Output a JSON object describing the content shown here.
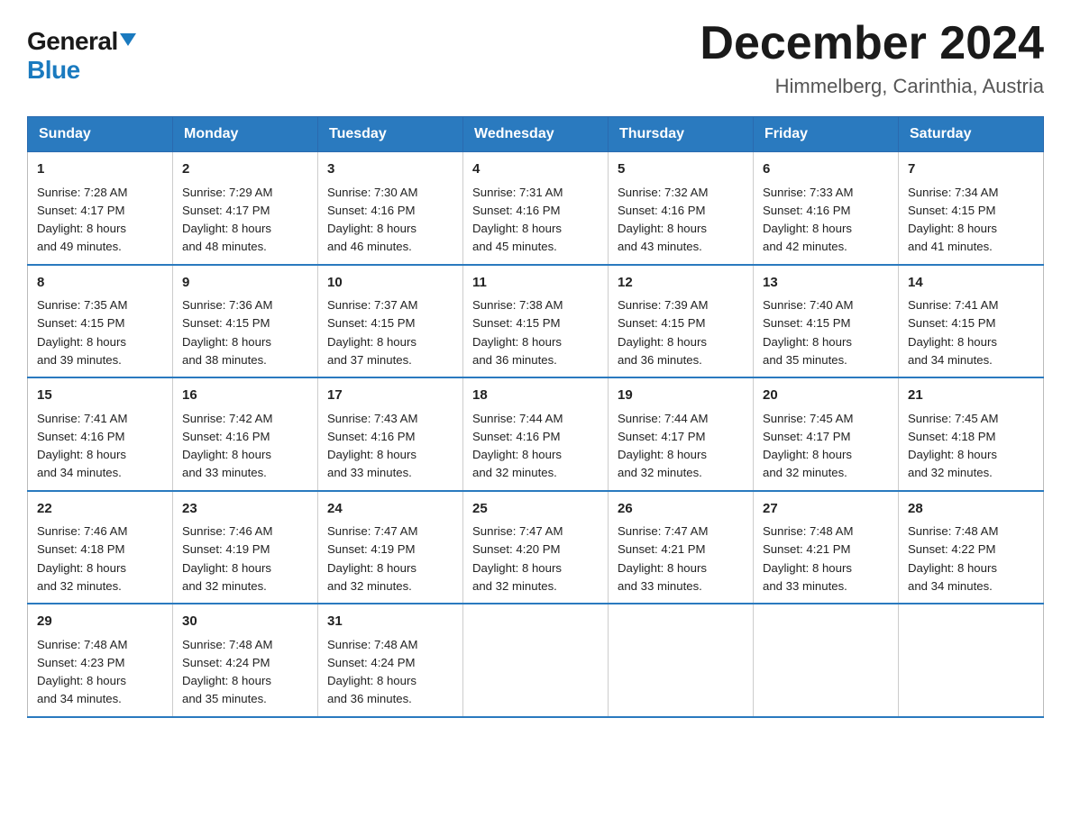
{
  "header": {
    "logo_general": "General",
    "logo_blue": "Blue",
    "title": "December 2024",
    "subtitle": "Himmelberg, Carinthia, Austria"
  },
  "days_of_week": [
    "Sunday",
    "Monday",
    "Tuesday",
    "Wednesday",
    "Thursday",
    "Friday",
    "Saturday"
  ],
  "weeks": [
    [
      {
        "day": "1",
        "sunrise": "Sunrise: 7:28 AM",
        "sunset": "Sunset: 4:17 PM",
        "daylight": "Daylight: 8 hours",
        "daylight2": "and 49 minutes."
      },
      {
        "day": "2",
        "sunrise": "Sunrise: 7:29 AM",
        "sunset": "Sunset: 4:17 PM",
        "daylight": "Daylight: 8 hours",
        "daylight2": "and 48 minutes."
      },
      {
        "day": "3",
        "sunrise": "Sunrise: 7:30 AM",
        "sunset": "Sunset: 4:16 PM",
        "daylight": "Daylight: 8 hours",
        "daylight2": "and 46 minutes."
      },
      {
        "day": "4",
        "sunrise": "Sunrise: 7:31 AM",
        "sunset": "Sunset: 4:16 PM",
        "daylight": "Daylight: 8 hours",
        "daylight2": "and 45 minutes."
      },
      {
        "day": "5",
        "sunrise": "Sunrise: 7:32 AM",
        "sunset": "Sunset: 4:16 PM",
        "daylight": "Daylight: 8 hours",
        "daylight2": "and 43 minutes."
      },
      {
        "day": "6",
        "sunrise": "Sunrise: 7:33 AM",
        "sunset": "Sunset: 4:16 PM",
        "daylight": "Daylight: 8 hours",
        "daylight2": "and 42 minutes."
      },
      {
        "day": "7",
        "sunrise": "Sunrise: 7:34 AM",
        "sunset": "Sunset: 4:15 PM",
        "daylight": "Daylight: 8 hours",
        "daylight2": "and 41 minutes."
      }
    ],
    [
      {
        "day": "8",
        "sunrise": "Sunrise: 7:35 AM",
        "sunset": "Sunset: 4:15 PM",
        "daylight": "Daylight: 8 hours",
        "daylight2": "and 39 minutes."
      },
      {
        "day": "9",
        "sunrise": "Sunrise: 7:36 AM",
        "sunset": "Sunset: 4:15 PM",
        "daylight": "Daylight: 8 hours",
        "daylight2": "and 38 minutes."
      },
      {
        "day": "10",
        "sunrise": "Sunrise: 7:37 AM",
        "sunset": "Sunset: 4:15 PM",
        "daylight": "Daylight: 8 hours",
        "daylight2": "and 37 minutes."
      },
      {
        "day": "11",
        "sunrise": "Sunrise: 7:38 AM",
        "sunset": "Sunset: 4:15 PM",
        "daylight": "Daylight: 8 hours",
        "daylight2": "and 36 minutes."
      },
      {
        "day": "12",
        "sunrise": "Sunrise: 7:39 AM",
        "sunset": "Sunset: 4:15 PM",
        "daylight": "Daylight: 8 hours",
        "daylight2": "and 36 minutes."
      },
      {
        "day": "13",
        "sunrise": "Sunrise: 7:40 AM",
        "sunset": "Sunset: 4:15 PM",
        "daylight": "Daylight: 8 hours",
        "daylight2": "and 35 minutes."
      },
      {
        "day": "14",
        "sunrise": "Sunrise: 7:41 AM",
        "sunset": "Sunset: 4:15 PM",
        "daylight": "Daylight: 8 hours",
        "daylight2": "and 34 minutes."
      }
    ],
    [
      {
        "day": "15",
        "sunrise": "Sunrise: 7:41 AM",
        "sunset": "Sunset: 4:16 PM",
        "daylight": "Daylight: 8 hours",
        "daylight2": "and 34 minutes."
      },
      {
        "day": "16",
        "sunrise": "Sunrise: 7:42 AM",
        "sunset": "Sunset: 4:16 PM",
        "daylight": "Daylight: 8 hours",
        "daylight2": "and 33 minutes."
      },
      {
        "day": "17",
        "sunrise": "Sunrise: 7:43 AM",
        "sunset": "Sunset: 4:16 PM",
        "daylight": "Daylight: 8 hours",
        "daylight2": "and 33 minutes."
      },
      {
        "day": "18",
        "sunrise": "Sunrise: 7:44 AM",
        "sunset": "Sunset: 4:16 PM",
        "daylight": "Daylight: 8 hours",
        "daylight2": "and 32 minutes."
      },
      {
        "day": "19",
        "sunrise": "Sunrise: 7:44 AM",
        "sunset": "Sunset: 4:17 PM",
        "daylight": "Daylight: 8 hours",
        "daylight2": "and 32 minutes."
      },
      {
        "day": "20",
        "sunrise": "Sunrise: 7:45 AM",
        "sunset": "Sunset: 4:17 PM",
        "daylight": "Daylight: 8 hours",
        "daylight2": "and 32 minutes."
      },
      {
        "day": "21",
        "sunrise": "Sunrise: 7:45 AM",
        "sunset": "Sunset: 4:18 PM",
        "daylight": "Daylight: 8 hours",
        "daylight2": "and 32 minutes."
      }
    ],
    [
      {
        "day": "22",
        "sunrise": "Sunrise: 7:46 AM",
        "sunset": "Sunset: 4:18 PM",
        "daylight": "Daylight: 8 hours",
        "daylight2": "and 32 minutes."
      },
      {
        "day": "23",
        "sunrise": "Sunrise: 7:46 AM",
        "sunset": "Sunset: 4:19 PM",
        "daylight": "Daylight: 8 hours",
        "daylight2": "and 32 minutes."
      },
      {
        "day": "24",
        "sunrise": "Sunrise: 7:47 AM",
        "sunset": "Sunset: 4:19 PM",
        "daylight": "Daylight: 8 hours",
        "daylight2": "and 32 minutes."
      },
      {
        "day": "25",
        "sunrise": "Sunrise: 7:47 AM",
        "sunset": "Sunset: 4:20 PM",
        "daylight": "Daylight: 8 hours",
        "daylight2": "and 32 minutes."
      },
      {
        "day": "26",
        "sunrise": "Sunrise: 7:47 AM",
        "sunset": "Sunset: 4:21 PM",
        "daylight": "Daylight: 8 hours",
        "daylight2": "and 33 minutes."
      },
      {
        "day": "27",
        "sunrise": "Sunrise: 7:48 AM",
        "sunset": "Sunset: 4:21 PM",
        "daylight": "Daylight: 8 hours",
        "daylight2": "and 33 minutes."
      },
      {
        "day": "28",
        "sunrise": "Sunrise: 7:48 AM",
        "sunset": "Sunset: 4:22 PM",
        "daylight": "Daylight: 8 hours",
        "daylight2": "and 34 minutes."
      }
    ],
    [
      {
        "day": "29",
        "sunrise": "Sunrise: 7:48 AM",
        "sunset": "Sunset: 4:23 PM",
        "daylight": "Daylight: 8 hours",
        "daylight2": "and 34 minutes."
      },
      {
        "day": "30",
        "sunrise": "Sunrise: 7:48 AM",
        "sunset": "Sunset: 4:24 PM",
        "daylight": "Daylight: 8 hours",
        "daylight2": "and 35 minutes."
      },
      {
        "day": "31",
        "sunrise": "Sunrise: 7:48 AM",
        "sunset": "Sunset: 4:24 PM",
        "daylight": "Daylight: 8 hours",
        "daylight2": "and 36 minutes."
      },
      null,
      null,
      null,
      null
    ]
  ]
}
